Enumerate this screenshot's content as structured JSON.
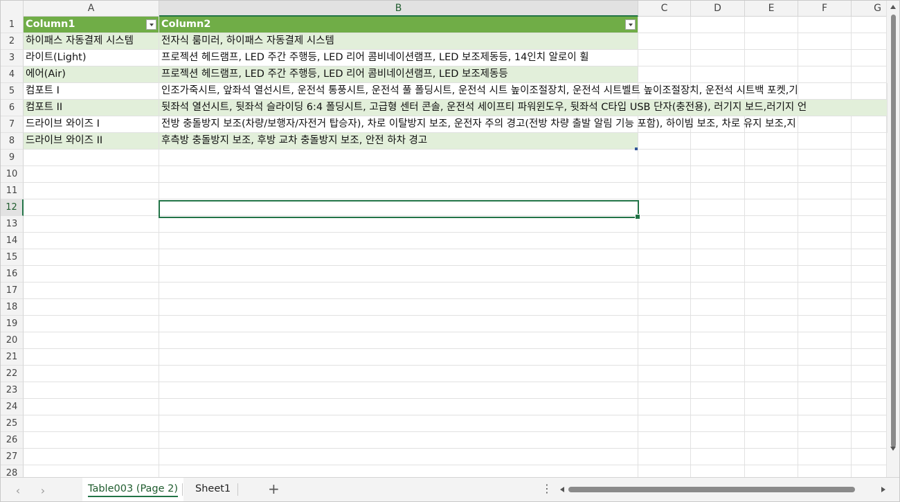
{
  "columns": [
    "A",
    "B",
    "C",
    "D",
    "E",
    "F",
    "G"
  ],
  "selected_column": "B",
  "rows": [
    "1",
    "2",
    "3",
    "4",
    "5",
    "6",
    "7",
    "8",
    "9",
    "10",
    "11",
    "12",
    "13",
    "14",
    "15",
    "16",
    "17",
    "18",
    "19",
    "20",
    "21",
    "22",
    "23",
    "24",
    "25",
    "26",
    "27",
    "28"
  ],
  "selected_row": "12",
  "table": {
    "headers": [
      "Column1",
      "Column2"
    ],
    "data": [
      [
        "하이패스 자동결제 시스템",
        "전자식 룸미러, 하이패스 자동결제 시스템"
      ],
      [
        "라이트(Light)",
        "프로젝션 헤드램프, LED 주간 주행등, LED 리어 콤비네이션램프, LED 보조제동등, 14인치 알로이 휠"
      ],
      [
        "에어(Air)",
        "프로젝션 헤드램프, LED 주간 주행등, LED 리어 콤비네이션램프, LED 보조제동등"
      ],
      [
        "컴포트 I",
        "인조가죽시트, 앞좌석 열선시트, 운전석 통풍시트, 운전석 풀 폴딩시트, 운전석 시트 높이조절장치, 운전석 시트벨트 높이조절장치, 운전석 시트백 포켓,기"
      ],
      [
        "컴포트 II",
        "뒷좌석 열선시트, 뒷좌석 슬라이딩 6:4 폴딩시트, 고급형 센터 콘솔, 운전석 세이프티 파워윈도우, 뒷좌석 C타입 USB 단자(충전용), 러기지 보드,러기지 언"
      ],
      [
        "드라이브 와이즈 I",
        "전방 충돌방지 보조(차량/보행자/자전거 탑승자), 차로 이탈방지 보조, 운전자 주의 경고(전방 차량 출발 알림 기능 포함), 하이빔 보조, 차로 유지 보조,지"
      ],
      [
        "드라이브 와이즈 II",
        "후측방 충돌방지 보조, 후방 교차 충돌방지 보조, 안전 하차 경고"
      ]
    ]
  },
  "sheet_tabs": [
    {
      "label": "Table003 (Page 2)",
      "active": true
    },
    {
      "label": "Sheet1",
      "active": false
    }
  ],
  "tab_bar": {
    "add_label": "+",
    "more_label": "⋮",
    "prev_label": "‹",
    "next_label": "›"
  },
  "colors": {
    "header_green": "#70ad47",
    "band_green": "#e2efda",
    "accent": "#217346"
  }
}
